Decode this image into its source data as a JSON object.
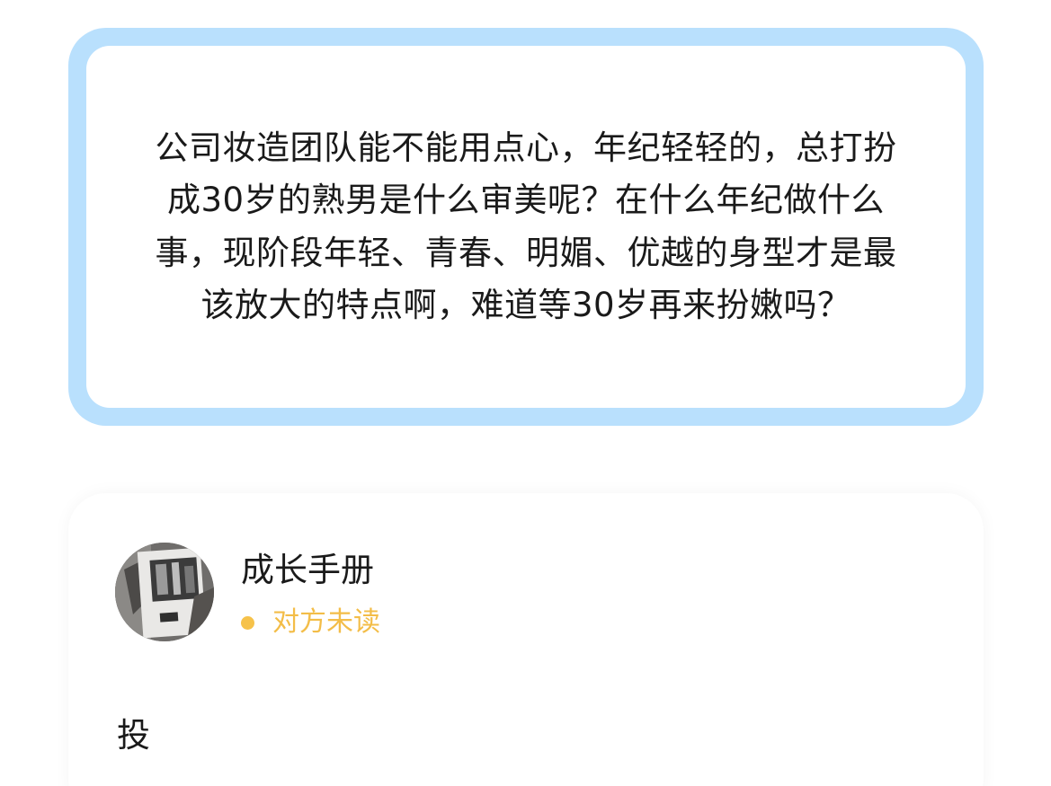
{
  "question": {
    "text": "公司妆造团队能不能用点心，年纪轻轻的，总打扮成30岁的熟男是什么审美呢？在什么年纪做什么事，现阶段年轻、青春、明媚、优越的身型才是最该放大的特点啊，难道等30岁再来扮嫩吗？"
  },
  "reply": {
    "author": {
      "name": "成长手册",
      "avatar_icon": "book-photo-avatar"
    },
    "status": {
      "text": "对方未读",
      "color": "#f6c24a"
    },
    "body": "投"
  },
  "colors": {
    "question_border": "#b9e0fd",
    "text": "#1a1a1a"
  }
}
